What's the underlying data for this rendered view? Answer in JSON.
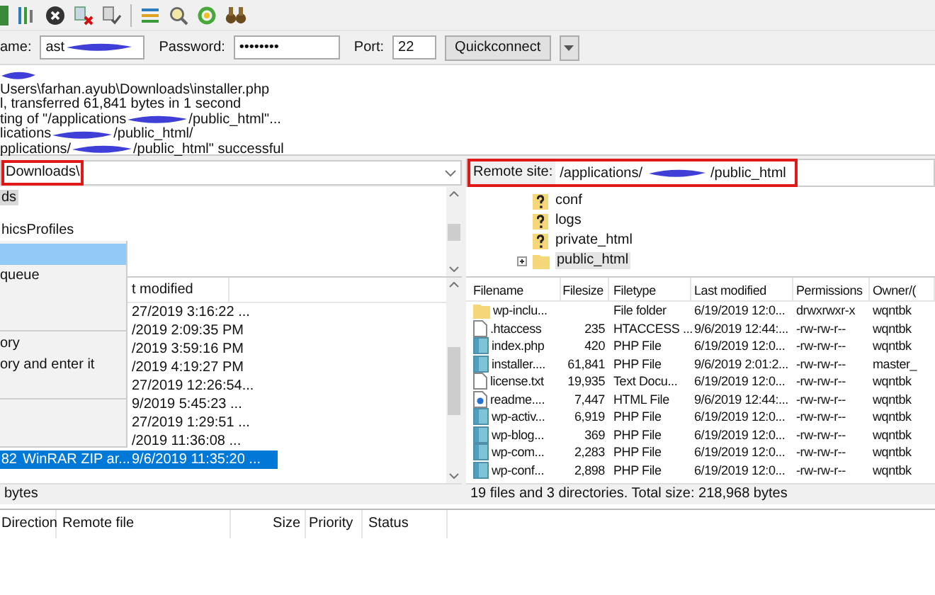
{
  "quickconnect": {
    "host_label": "ame:",
    "host_value": "ast",
    "password_label": "Password:",
    "password_value": "••••••••",
    "port_label": "Port:",
    "port_value": "22",
    "button": "Quickconnect"
  },
  "log": [
    [
      {
        "kind": "redaction"
      }
    ],
    [
      {
        "kind": "text",
        "text": "Users\\farhan.ayub\\Downloads\\installer.php"
      }
    ],
    [
      {
        "kind": "text",
        "text": "l, transferred 61,841 bytes in 1 second"
      }
    ],
    [
      {
        "kind": "text",
        "text": "ting of \"/applications"
      },
      {
        "kind": "redaction"
      },
      {
        "kind": "text",
        "text": "/public_html\"..."
      }
    ],
    [
      {
        "kind": "text",
        "text": "lications"
      },
      {
        "kind": "redaction"
      },
      {
        "kind": "text",
        "text": "/public_html/"
      }
    ],
    [
      {
        "kind": "text",
        "text": "pplications/"
      },
      {
        "kind": "redaction"
      },
      {
        "kind": "text",
        "text": "/public_html\" successful"
      }
    ]
  ],
  "local": {
    "path": "Downloads\\",
    "tree": [
      {
        "label": "ds",
        "selected": true
      },
      {
        "label": "hicsProfiles",
        "selected": false
      }
    ],
    "context_menu": [
      {
        "kind": "item",
        "highlighted": true
      },
      {
        "kind": "item",
        "label": "queue",
        "highlighted": false
      },
      {
        "kind": "item",
        "highlighted": false
      },
      {
        "kind": "item",
        "highlighted": false
      },
      {
        "kind": "separator"
      },
      {
        "kind": "item",
        "label": "ory",
        "highlighted": false
      },
      {
        "kind": "item",
        "label": "ory and enter it",
        "highlighted": false
      },
      {
        "kind": "item",
        "highlighted": false
      },
      {
        "kind": "separator"
      },
      {
        "kind": "item",
        "highlighted": false
      },
      {
        "kind": "item",
        "highlighted": false
      }
    ],
    "columns": [
      "t modified"
    ],
    "files": [
      {
        "modified": "27/2019 3:16:22 ...",
        "selected": false
      },
      {
        "modified": "/2019 2:09:35 PM",
        "selected": false
      },
      {
        "modified": "/2019 3:59:16 PM",
        "selected": false
      },
      {
        "modified": "/2019 4:19:27 PM",
        "selected": false
      },
      {
        "modified": "27/2019 12:26:54...",
        "selected": false
      },
      {
        "modified": "9/2019 5:45:23 ...",
        "selected": false
      },
      {
        "modified": "27/2019 1:29:51 ...",
        "selected": false
      },
      {
        "modified": "/2019 11:36:08 ...",
        "selected": false
      },
      {
        "size": "82",
        "type": "WinRAR ZIP ar...",
        "modified": "9/6/2019 11:35:20 ...",
        "selected": true
      }
    ],
    "status": "bytes"
  },
  "remote": {
    "label": "Remote site:",
    "path_before": "/applications/",
    "path_after": "/public_html",
    "tree": [
      {
        "label": "conf",
        "kind": "unknown",
        "expandable": false,
        "selected": false
      },
      {
        "label": "logs",
        "kind": "unknown",
        "expandable": false,
        "selected": false
      },
      {
        "label": "private_html",
        "kind": "unknown",
        "expandable": false,
        "selected": false
      },
      {
        "label": "public_html",
        "kind": "folder",
        "expandable": true,
        "selected": true
      }
    ],
    "columns": [
      "Filename",
      "Filesize",
      "Filetype",
      "Last modified",
      "Permissions",
      "Owner/("
    ],
    "files": [
      {
        "kind": "folder",
        "name": "wp-inclu...",
        "type": "File folder",
        "modified": "6/19/2019 12:0...",
        "permissions": "drwxrwxr-x",
        "owner": "wqntbk"
      },
      {
        "kind": "text",
        "name": ".htaccess",
        "size": "235",
        "type": "HTACCESS ...",
        "modified": "9/6/2019 12:44:...",
        "permissions": "-rw-rw-r--",
        "owner": "wqntbk"
      },
      {
        "kind": "php",
        "name": "index.php",
        "size": "420",
        "type": "PHP File",
        "modified": "6/19/2019 12:0...",
        "permissions": "-rw-rw-r--",
        "owner": "wqntbk"
      },
      {
        "kind": "php",
        "name": "installer....",
        "size": "61,841",
        "type": "PHP File",
        "modified": "9/6/2019 2:01:2...",
        "permissions": "-rw-rw-r--",
        "owner": "master_"
      },
      {
        "kind": "text",
        "name": "license.txt",
        "size": "19,935",
        "type": "Text Docu...",
        "modified": "6/19/2019 12:0...",
        "permissions": "-rw-rw-r--",
        "owner": "wqntbk"
      },
      {
        "kind": "html",
        "name": "readme....",
        "size": "7,447",
        "type": "HTML File",
        "modified": "9/6/2019 12:44:...",
        "permissions": "-rw-rw-r--",
        "owner": "wqntbk"
      },
      {
        "kind": "php",
        "name": "wp-activ...",
        "size": "6,919",
        "type": "PHP File",
        "modified": "6/19/2019 12:0...",
        "permissions": "-rw-rw-r--",
        "owner": "wqntbk"
      },
      {
        "kind": "php",
        "name": "wp-blog...",
        "size": "369",
        "type": "PHP File",
        "modified": "6/19/2019 12:0...",
        "permissions": "-rw-rw-r--",
        "owner": "wqntbk"
      },
      {
        "kind": "php",
        "name": "wp-com...",
        "size": "2,283",
        "type": "PHP File",
        "modified": "6/19/2019 12:0...",
        "permissions": "-rw-rw-r--",
        "owner": "wqntbk"
      },
      {
        "kind": "php",
        "name": "wp-conf...",
        "size": "2,898",
        "type": "PHP File",
        "modified": "6/19/2019 12:0...",
        "permissions": "-rw-rw-r--",
        "owner": "wqntbk"
      }
    ],
    "status": "19 files and 3 directories. Total size: 218,968 bytes"
  },
  "queue": {
    "columns": [
      "Direction",
      "Remote file",
      "Size",
      "Priority",
      "Status"
    ]
  }
}
